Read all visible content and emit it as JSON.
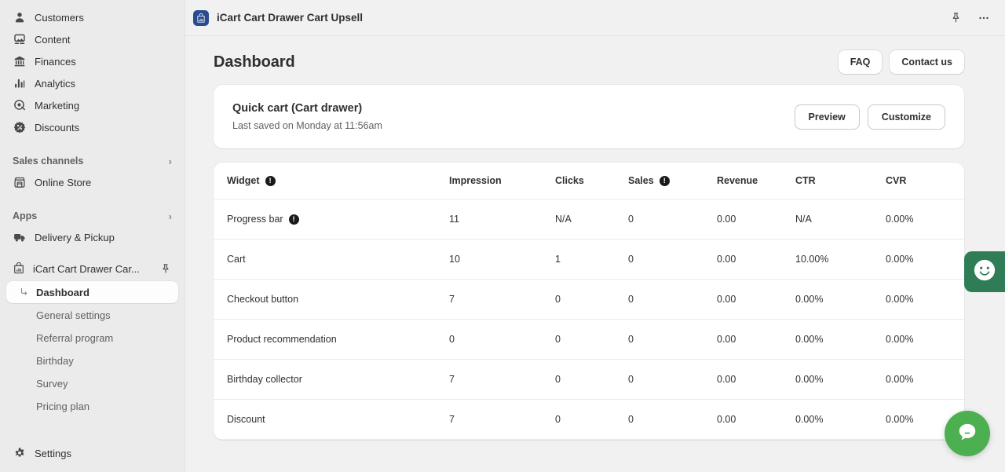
{
  "sidebar": {
    "main_items": [
      {
        "label": "Customers",
        "icon": "person-icon"
      },
      {
        "label": "Content",
        "icon": "content-icon"
      },
      {
        "label": "Finances",
        "icon": "bank-icon"
      },
      {
        "label": "Analytics",
        "icon": "bar-chart-icon"
      },
      {
        "label": "Marketing",
        "icon": "target-icon"
      },
      {
        "label": "Discounts",
        "icon": "discount-badge-icon"
      }
    ],
    "sales_channels": {
      "label": "Sales channels",
      "chevron": "›"
    },
    "sales_channel_items": [
      {
        "label": "Online Store",
        "icon": "storefront-icon"
      }
    ],
    "apps": {
      "label": "Apps",
      "chevron": "›"
    },
    "app_items": [
      {
        "label": "Delivery & Pickup",
        "icon": "truck-icon"
      }
    ],
    "active_app": {
      "label": "iCart Cart Drawer Car...",
      "icon": "icart-bag-icon",
      "pin": "pin-icon"
    },
    "sub_items": [
      {
        "label": "Dashboard",
        "active": true
      },
      {
        "label": "General settings",
        "active": false
      },
      {
        "label": "Referral program",
        "active": false
      },
      {
        "label": "Birthday",
        "active": false
      },
      {
        "label": "Survey",
        "active": false
      },
      {
        "label": "Pricing plan",
        "active": false
      }
    ],
    "bottom_items": [
      {
        "label": "Settings",
        "icon": "gear-icon"
      }
    ]
  },
  "topbar": {
    "app_title": "iCart Cart Drawer Cart Upsell",
    "app_icon": "icart-app-icon",
    "pin_icon": "pin-icon",
    "more_icon": "more-horizontal-icon"
  },
  "page": {
    "title": "Dashboard",
    "faq_label": "FAQ",
    "contact_label": "Contact us"
  },
  "quick_cart": {
    "title": "Quick cart (Cart drawer)",
    "subtitle": "Last saved on Monday at 11:56am",
    "preview_label": "Preview",
    "customize_label": "Customize"
  },
  "table": {
    "columns": [
      {
        "label": "Widget",
        "info": true
      },
      {
        "label": "Impression",
        "info": false
      },
      {
        "label": "Clicks",
        "info": false
      },
      {
        "label": "Sales",
        "info": true
      },
      {
        "label": "Revenue",
        "info": false
      },
      {
        "label": "CTR",
        "info": false
      },
      {
        "label": "CVR",
        "info": false
      }
    ],
    "rows": [
      {
        "widget": "Progress bar",
        "info": true,
        "impression": "11",
        "clicks": "N/A",
        "sales": "0",
        "revenue": "0.00",
        "ctr": "N/A",
        "cvr": "0.00%"
      },
      {
        "widget": "Cart",
        "info": false,
        "impression": "10",
        "clicks": "1",
        "sales": "0",
        "revenue": "0.00",
        "ctr": "10.00%",
        "cvr": "0.00%"
      },
      {
        "widget": "Checkout button",
        "info": false,
        "impression": "7",
        "clicks": "0",
        "sales": "0",
        "revenue": "0.00",
        "ctr": "0.00%",
        "cvr": "0.00%"
      },
      {
        "widget": "Product recommendation",
        "info": false,
        "impression": "0",
        "clicks": "0",
        "sales": "0",
        "revenue": "0.00",
        "ctr": "0.00%",
        "cvr": "0.00%"
      },
      {
        "widget": "Birthday collector",
        "info": false,
        "impression": "7",
        "clicks": "0",
        "sales": "0",
        "revenue": "0.00",
        "ctr": "0.00%",
        "cvr": "0.00%"
      },
      {
        "widget": "Discount",
        "info": false,
        "impression": "7",
        "clicks": "0",
        "sales": "0",
        "revenue": "0.00",
        "ctr": "0.00%",
        "cvr": "0.00%"
      }
    ],
    "info_glyph": "!"
  },
  "chat": {
    "tab_icon": "smiley-face-icon",
    "bubble_icon": "chat-bubble-icon"
  },
  "colors": {
    "accent_green": "#4caf50",
    "tab_green": "#2e7d57",
    "app_icon_blue": "#2a4b8d",
    "sidebar_bg": "#ebebeb",
    "page_bg": "#f1f1f1"
  }
}
